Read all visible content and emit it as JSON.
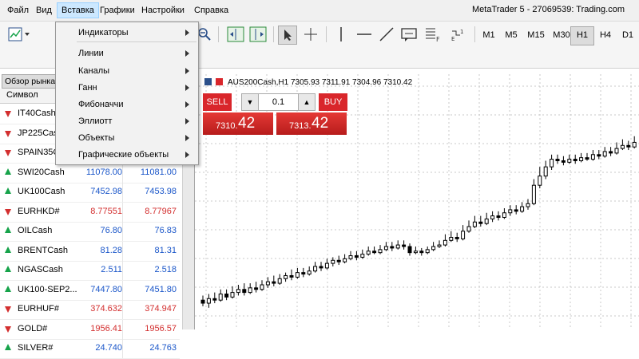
{
  "menubar": {
    "items": [
      "Файл",
      "Вид",
      "Вставка",
      "Графики",
      "Настройки",
      "Справка"
    ],
    "title": "MetaTrader 5 - 27069539: Trading.com"
  },
  "toolbar": {
    "timeframes": [
      "M1",
      "M5",
      "M15",
      "M30",
      "H1",
      "H4",
      "D1"
    ],
    "active_timeframe": "H1",
    "icons": [
      "new-chart-icon",
      "zoom-in-icon",
      "zoom-out-icon",
      "chart-shift-icon",
      "autoscroll-icon",
      "cursor-icon",
      "crosshair-icon",
      "vertical-line-icon",
      "horizontal-line-icon",
      "trend-line-icon",
      "text-label-icon",
      "fibonacci-icon",
      "elliott-wave-icon"
    ]
  },
  "insert_menu": {
    "items": [
      {
        "label": "Индикаторы"
      },
      {
        "label": "Линии"
      },
      {
        "label": "Каналы"
      },
      {
        "label": "Ганн"
      },
      {
        "label": "Фибоначчи"
      },
      {
        "label": "Эллиотт"
      },
      {
        "label": "Объекты"
      },
      {
        "label": "Графические объекты"
      }
    ]
  },
  "market_watch": {
    "title": "Обзор рынка",
    "column_symbol": "Символ",
    "rows": [
      {
        "symbol": "IT40Cash",
        "bid": "",
        "ask": "",
        "dir": "down"
      },
      {
        "symbol": "JP225Cas",
        "bid": "",
        "ask": "",
        "dir": "down"
      },
      {
        "symbol": "SPAIN35C",
        "bid": "",
        "ask": "",
        "dir": "down"
      },
      {
        "symbol": "SWI20Cash",
        "bid": "11078.00",
        "ask": "11081.00",
        "dir": "up"
      },
      {
        "symbol": "UK100Cash",
        "bid": "7452.98",
        "ask": "7453.98",
        "dir": "up"
      },
      {
        "symbol": "EURHKD#",
        "bid": "8.77551",
        "ask": "8.77967",
        "dir": "down"
      },
      {
        "symbol": "OILCash",
        "bid": "76.80",
        "ask": "76.83",
        "dir": "up"
      },
      {
        "symbol": "BRENTCash",
        "bid": "81.28",
        "ask": "81.31",
        "dir": "up"
      },
      {
        "symbol": "NGASCash",
        "bid": "2.511",
        "ask": "2.518",
        "dir": "up"
      },
      {
        "symbol": "UK100-SEP2...",
        "bid": "7447.80",
        "ask": "7451.80",
        "dir": "up"
      },
      {
        "symbol": "EURHUF#",
        "bid": "374.632",
        "ask": "374.947",
        "dir": "down"
      },
      {
        "symbol": "GOLD#",
        "bid": "1956.41",
        "ask": "1956.57",
        "dir": "down"
      },
      {
        "symbol": "SILVER#",
        "bid": "24.740",
        "ask": "24.763",
        "dir": "up"
      }
    ]
  },
  "chart": {
    "header": "AUS200Cash,H1  7305.93 7311.91 7304.96 7310.42",
    "sell_label": "SELL",
    "buy_label": "BUY",
    "lot": "0.1",
    "sell_price_small": "7310.",
    "sell_price_big": "42",
    "buy_price_small": "7313.",
    "buy_price_big": "42",
    "candles": [
      [
        7285,
        7283,
        7288,
        7281
      ],
      [
        7283,
        7286,
        7289,
        7280
      ],
      [
        7286,
        7285,
        7290,
        7283
      ],
      [
        7285,
        7289,
        7292,
        7284
      ],
      [
        7289,
        7287,
        7292,
        7285
      ],
      [
        7287,
        7290,
        7294,
        7286
      ],
      [
        7290,
        7292,
        7295,
        7288
      ],
      [
        7292,
        7290,
        7296,
        7288
      ],
      [
        7290,
        7293,
        7296,
        7289
      ],
      [
        7293,
        7292,
        7297,
        7290
      ],
      [
        7292,
        7295,
        7298,
        7291
      ],
      [
        7295,
        7297,
        7300,
        7293
      ],
      [
        7297,
        7296,
        7301,
        7294
      ],
      [
        7296,
        7299,
        7302,
        7295
      ],
      [
        7299,
        7301,
        7303,
        7297
      ],
      [
        7301,
        7300,
        7305,
        7298
      ],
      [
        7300,
        7303,
        7306,
        7299
      ],
      [
        7303,
        7302,
        7306,
        7300
      ],
      [
        7302,
        7304,
        7307,
        7301
      ],
      [
        7304,
        7307,
        7310,
        7303
      ],
      [
        7307,
        7306,
        7310,
        7304
      ],
      [
        7306,
        7309,
        7312,
        7305
      ],
      [
        7309,
        7311,
        7313,
        7307
      ],
      [
        7311,
        7310,
        7314,
        7308
      ],
      [
        7310,
        7312,
        7315,
        7309
      ],
      [
        7312,
        7314,
        7317,
        7311
      ],
      [
        7314,
        7313,
        7317,
        7311
      ],
      [
        7313,
        7315,
        7318,
        7312
      ],
      [
        7315,
        7317,
        7320,
        7314
      ],
      [
        7317,
        7316,
        7320,
        7315
      ],
      [
        7316,
        7318,
        7321,
        7315
      ],
      [
        7318,
        7320,
        7323,
        7317
      ],
      [
        7320,
        7319,
        7323,
        7317
      ],
      [
        7319,
        7321,
        7324,
        7318
      ],
      [
        7321,
        7320,
        7324,
        7318
      ],
      [
        7320,
        7316,
        7322,
        7314
      ],
      [
        7316,
        7317,
        7320,
        7315
      ],
      [
        7317,
        7316,
        7319,
        7314
      ],
      [
        7316,
        7318,
        7320,
        7315
      ],
      [
        7318,
        7320,
        7323,
        7317
      ],
      [
        7320,
        7321,
        7324,
        7319
      ],
      [
        7321,
        7324,
        7328,
        7320
      ],
      [
        7324,
        7326,
        7330,
        7323
      ],
      [
        7326,
        7325,
        7329,
        7323
      ],
      [
        7325,
        7330,
        7334,
        7324
      ],
      [
        7330,
        7333,
        7337,
        7329
      ],
      [
        7333,
        7336,
        7340,
        7332
      ],
      [
        7336,
        7335,
        7340,
        7333
      ],
      [
        7335,
        7338,
        7342,
        7334
      ],
      [
        7338,
        7340,
        7343,
        7336
      ],
      [
        7340,
        7339,
        7343,
        7337
      ],
      [
        7339,
        7342,
        7345,
        7338
      ],
      [
        7342,
        7344,
        7347,
        7340
      ],
      [
        7344,
        7343,
        7347,
        7341
      ],
      [
        7343,
        7346,
        7349,
        7342
      ],
      [
        7346,
        7348,
        7351,
        7344
      ],
      [
        7348,
        7360,
        7364,
        7347
      ],
      [
        7360,
        7366,
        7372,
        7358
      ],
      [
        7366,
        7372,
        7376,
        7364
      ],
      [
        7372,
        7377,
        7380,
        7370
      ],
      [
        7377,
        7376,
        7380,
        7374
      ],
      [
        7376,
        7375,
        7379,
        7373
      ],
      [
        7375,
        7377,
        7380,
        7374
      ],
      [
        7377,
        7376,
        7380,
        7374
      ],
      [
        7376,
        7378,
        7381,
        7375
      ],
      [
        7378,
        7377,
        7381,
        7376
      ],
      [
        7377,
        7380,
        7383,
        7376
      ],
      [
        7380,
        7379,
        7383,
        7377
      ],
      [
        7379,
        7382,
        7385,
        7378
      ],
      [
        7382,
        7381,
        7385,
        7379
      ],
      [
        7381,
        7384,
        7388,
        7380
      ],
      [
        7384,
        7386,
        7390,
        7383
      ],
      [
        7386,
        7385,
        7389,
        7383
      ],
      [
        7385,
        7388,
        7392,
        7384
      ]
    ]
  }
}
